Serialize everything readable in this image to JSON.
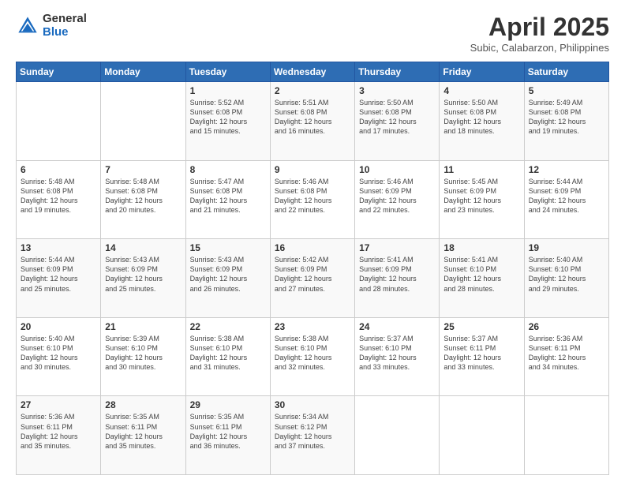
{
  "header": {
    "logo_general": "General",
    "logo_blue": "Blue",
    "title": "April 2025",
    "location": "Subic, Calabarzon, Philippines"
  },
  "weekdays": [
    "Sunday",
    "Monday",
    "Tuesday",
    "Wednesday",
    "Thursday",
    "Friday",
    "Saturday"
  ],
  "weeks": [
    [
      {
        "day": "",
        "info": ""
      },
      {
        "day": "",
        "info": ""
      },
      {
        "day": "1",
        "info": "Sunrise: 5:52 AM\nSunset: 6:08 PM\nDaylight: 12 hours\nand 15 minutes."
      },
      {
        "day": "2",
        "info": "Sunrise: 5:51 AM\nSunset: 6:08 PM\nDaylight: 12 hours\nand 16 minutes."
      },
      {
        "day": "3",
        "info": "Sunrise: 5:50 AM\nSunset: 6:08 PM\nDaylight: 12 hours\nand 17 minutes."
      },
      {
        "day": "4",
        "info": "Sunrise: 5:50 AM\nSunset: 6:08 PM\nDaylight: 12 hours\nand 18 minutes."
      },
      {
        "day": "5",
        "info": "Sunrise: 5:49 AM\nSunset: 6:08 PM\nDaylight: 12 hours\nand 19 minutes."
      }
    ],
    [
      {
        "day": "6",
        "info": "Sunrise: 5:48 AM\nSunset: 6:08 PM\nDaylight: 12 hours\nand 19 minutes."
      },
      {
        "day": "7",
        "info": "Sunrise: 5:48 AM\nSunset: 6:08 PM\nDaylight: 12 hours\nand 20 minutes."
      },
      {
        "day": "8",
        "info": "Sunrise: 5:47 AM\nSunset: 6:08 PM\nDaylight: 12 hours\nand 21 minutes."
      },
      {
        "day": "9",
        "info": "Sunrise: 5:46 AM\nSunset: 6:08 PM\nDaylight: 12 hours\nand 22 minutes."
      },
      {
        "day": "10",
        "info": "Sunrise: 5:46 AM\nSunset: 6:09 PM\nDaylight: 12 hours\nand 22 minutes."
      },
      {
        "day": "11",
        "info": "Sunrise: 5:45 AM\nSunset: 6:09 PM\nDaylight: 12 hours\nand 23 minutes."
      },
      {
        "day": "12",
        "info": "Sunrise: 5:44 AM\nSunset: 6:09 PM\nDaylight: 12 hours\nand 24 minutes."
      }
    ],
    [
      {
        "day": "13",
        "info": "Sunrise: 5:44 AM\nSunset: 6:09 PM\nDaylight: 12 hours\nand 25 minutes."
      },
      {
        "day": "14",
        "info": "Sunrise: 5:43 AM\nSunset: 6:09 PM\nDaylight: 12 hours\nand 25 minutes."
      },
      {
        "day": "15",
        "info": "Sunrise: 5:43 AM\nSunset: 6:09 PM\nDaylight: 12 hours\nand 26 minutes."
      },
      {
        "day": "16",
        "info": "Sunrise: 5:42 AM\nSunset: 6:09 PM\nDaylight: 12 hours\nand 27 minutes."
      },
      {
        "day": "17",
        "info": "Sunrise: 5:41 AM\nSunset: 6:09 PM\nDaylight: 12 hours\nand 28 minutes."
      },
      {
        "day": "18",
        "info": "Sunrise: 5:41 AM\nSunset: 6:10 PM\nDaylight: 12 hours\nand 28 minutes."
      },
      {
        "day": "19",
        "info": "Sunrise: 5:40 AM\nSunset: 6:10 PM\nDaylight: 12 hours\nand 29 minutes."
      }
    ],
    [
      {
        "day": "20",
        "info": "Sunrise: 5:40 AM\nSunset: 6:10 PM\nDaylight: 12 hours\nand 30 minutes."
      },
      {
        "day": "21",
        "info": "Sunrise: 5:39 AM\nSunset: 6:10 PM\nDaylight: 12 hours\nand 30 minutes."
      },
      {
        "day": "22",
        "info": "Sunrise: 5:38 AM\nSunset: 6:10 PM\nDaylight: 12 hours\nand 31 minutes."
      },
      {
        "day": "23",
        "info": "Sunrise: 5:38 AM\nSunset: 6:10 PM\nDaylight: 12 hours\nand 32 minutes."
      },
      {
        "day": "24",
        "info": "Sunrise: 5:37 AM\nSunset: 6:10 PM\nDaylight: 12 hours\nand 33 minutes."
      },
      {
        "day": "25",
        "info": "Sunrise: 5:37 AM\nSunset: 6:11 PM\nDaylight: 12 hours\nand 33 minutes."
      },
      {
        "day": "26",
        "info": "Sunrise: 5:36 AM\nSunset: 6:11 PM\nDaylight: 12 hours\nand 34 minutes."
      }
    ],
    [
      {
        "day": "27",
        "info": "Sunrise: 5:36 AM\nSunset: 6:11 PM\nDaylight: 12 hours\nand 35 minutes."
      },
      {
        "day": "28",
        "info": "Sunrise: 5:35 AM\nSunset: 6:11 PM\nDaylight: 12 hours\nand 35 minutes."
      },
      {
        "day": "29",
        "info": "Sunrise: 5:35 AM\nSunset: 6:11 PM\nDaylight: 12 hours\nand 36 minutes."
      },
      {
        "day": "30",
        "info": "Sunrise: 5:34 AM\nSunset: 6:12 PM\nDaylight: 12 hours\nand 37 minutes."
      },
      {
        "day": "",
        "info": ""
      },
      {
        "day": "",
        "info": ""
      },
      {
        "day": "",
        "info": ""
      }
    ]
  ]
}
